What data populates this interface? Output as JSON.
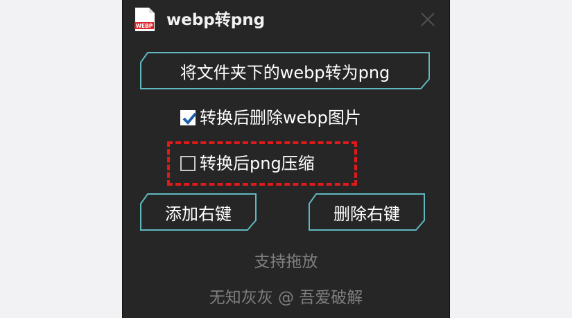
{
  "window": {
    "title": "webp转png",
    "app_icon_text": "WEBP"
  },
  "buttons": {
    "convert_folder": "将文件夹下的webp转为png",
    "add_context_menu": "添加右键",
    "remove_context_menu": "删除右键"
  },
  "options": {
    "delete_webp": {
      "label": "转换后删除webp图片",
      "checked": true
    },
    "compress_png": {
      "label": "转换后png压缩",
      "checked": false
    }
  },
  "hints": {
    "drag_drop": "支持拖放",
    "credit": "无知灰灰 @ 吾爱破解"
  },
  "colors": {
    "window_bg": "#262626",
    "button_border": "#5fb8c0",
    "highlight_dash": "#e01a1a",
    "muted_text": "#7f7f7f"
  }
}
